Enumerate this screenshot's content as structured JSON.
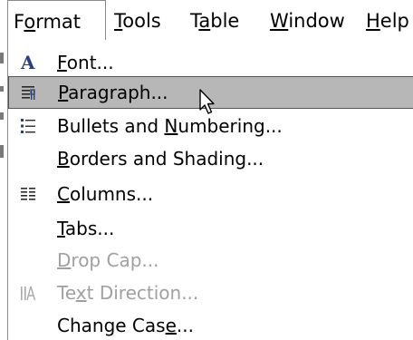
{
  "menubar": {
    "format": {
      "pre": "F",
      "u": "o",
      "post": "rmat"
    },
    "tools": {
      "u": "T",
      "post": "ools"
    },
    "table": {
      "pre": "T",
      "u": "a",
      "post": "ble"
    },
    "window": {
      "u": "W",
      "post": "indow"
    },
    "help": {
      "u": "H",
      "post": "elp"
    }
  },
  "menu": {
    "items": [
      {
        "pre": "",
        "u": "F",
        "post": "ont...",
        "icon": "font-icon",
        "enabled": true
      },
      {
        "pre": "",
        "u": "P",
        "post": "aragraph...",
        "icon": "paragraph-icon",
        "enabled": true,
        "highlighted": true
      },
      {
        "pre": "Bullets and ",
        "u": "N",
        "post": "umbering...",
        "icon": "bullets-icon",
        "enabled": true
      },
      {
        "pre": "",
        "u": "B",
        "post": "orders and Shading...",
        "icon": "",
        "enabled": true
      },
      {
        "pre": "",
        "u": "C",
        "post": "olumns...",
        "icon": "columns-icon",
        "enabled": true
      },
      {
        "pre": "",
        "u": "T",
        "post": "abs...",
        "icon": "",
        "enabled": true
      },
      {
        "pre": "",
        "u": "D",
        "post": "rop Cap...",
        "icon": "",
        "enabled": false
      },
      {
        "pre": "Te",
        "u": "x",
        "post": "t Direction...",
        "icon": "text-direction-icon",
        "enabled": false
      },
      {
        "pre": "Change Cas",
        "u": "e",
        "post": "...",
        "icon": "",
        "enabled": true
      }
    ]
  },
  "icons": {
    "font_glyph": "A"
  },
  "colors": {
    "highlight": "#b7b7b7",
    "disabled_text": "#a0a0a0",
    "icon_blue": "#2b3f7a"
  }
}
